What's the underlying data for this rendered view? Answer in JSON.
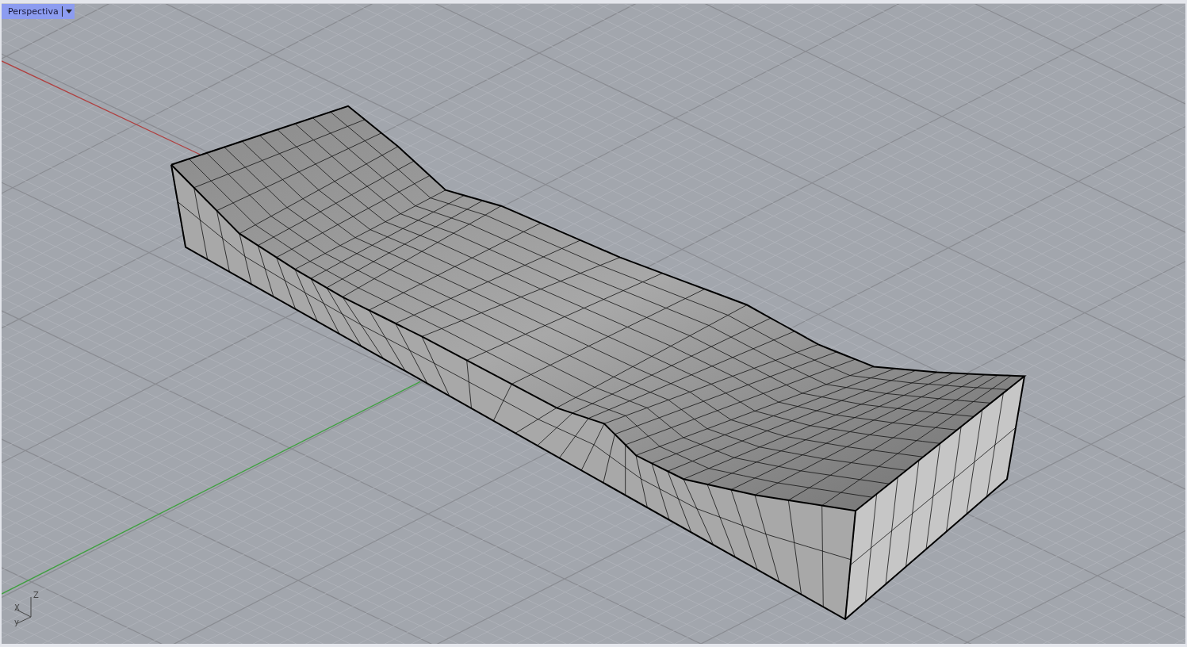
{
  "viewport": {
    "title": "Perspectiva",
    "axis_labels": [
      "Z",
      "X",
      "y"
    ]
  }
}
